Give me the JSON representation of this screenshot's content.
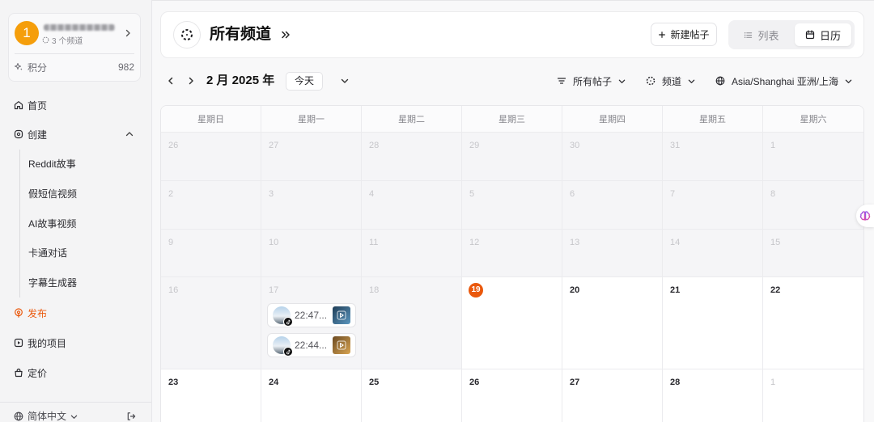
{
  "colors": {
    "accent": "#ea580c",
    "avatar": "#f59e0b",
    "past_cell": "#f5f5f7"
  },
  "sidebar": {
    "user": {
      "avatar_text": "1",
      "channels": "3 个频道",
      "channels_icon": "dotted-circle-icon"
    },
    "points": {
      "label": "积分",
      "value": "982",
      "icon": "sparkle-icon"
    },
    "home": {
      "label": "首页",
      "icon": "home-icon"
    },
    "create": {
      "label": "创建",
      "icon": "create-icon",
      "expanded": true,
      "items": [
        "Reddit故事",
        "假短信视频",
        "AI故事视频",
        "卡通对话",
        "字幕生成器"
      ]
    },
    "publish": {
      "label": "发布",
      "icon": "broadcast-icon",
      "active": true
    },
    "projects": {
      "label": "我的项目",
      "icon": "play-square-icon"
    },
    "pricing": {
      "label": "定价",
      "icon": "bag-icon"
    },
    "language": {
      "label": "简体中文",
      "icon": "globe-icon"
    }
  },
  "header": {
    "title": "所有频道",
    "new_post": "新建帖子",
    "views": [
      {
        "label": "列表",
        "icon": "list-icon"
      },
      {
        "label": "日历",
        "icon": "calendar-icon"
      }
    ],
    "active_view_index": 1
  },
  "toolbar": {
    "month": "2 月 2025 年",
    "today": "今天",
    "post_filter": "所有帖子",
    "channel_filter": "频道",
    "timezone": "Asia/Shanghai 亚洲/上海"
  },
  "calendar": {
    "weekdays": [
      "星期日",
      "星期一",
      "星期二",
      "星期三",
      "星期四",
      "星期五",
      "星期六"
    ],
    "weeks": [
      [
        {
          "day": 26,
          "past": true,
          "other_month": true
        },
        {
          "day": 27,
          "past": true,
          "other_month": true
        },
        {
          "day": 28,
          "past": true,
          "other_month": true
        },
        {
          "day": 29,
          "past": true,
          "other_month": true
        },
        {
          "day": 30,
          "past": true,
          "other_month": true
        },
        {
          "day": 31,
          "past": true,
          "other_month": true
        },
        {
          "day": 1,
          "past": true
        }
      ],
      [
        {
          "day": 2,
          "past": true
        },
        {
          "day": 3,
          "past": true
        },
        {
          "day": 4,
          "past": true
        },
        {
          "day": 5,
          "past": true
        },
        {
          "day": 6,
          "past": true
        },
        {
          "day": 7,
          "past": true
        },
        {
          "day": 8,
          "past": true
        }
      ],
      [
        {
          "day": 9,
          "past": true
        },
        {
          "day": 10,
          "past": true
        },
        {
          "day": 11,
          "past": true
        },
        {
          "day": 12,
          "past": true
        },
        {
          "day": 13,
          "past": true
        },
        {
          "day": 14,
          "past": true
        },
        {
          "day": 15,
          "past": true
        }
      ],
      [
        {
          "day": 16,
          "past": true
        },
        {
          "day": 17,
          "past": true,
          "posts": [
            {
              "time": "22:47...",
              "platform_icon": "tiktok-icon",
              "thumb_colors": [
                "#1f3d57",
                "#5b97bf"
              ]
            },
            {
              "time": "22:44...",
              "platform_icon": "tiktok-icon",
              "thumb_colors": [
                "#6b4a22",
                "#d9a552"
              ]
            }
          ]
        },
        {
          "day": 18,
          "past": true
        },
        {
          "day": 19,
          "today": true
        },
        {
          "day": 20
        },
        {
          "day": 21
        },
        {
          "day": 22
        }
      ],
      [
        {
          "day": 23
        },
        {
          "day": 24
        },
        {
          "day": 25
        },
        {
          "day": 26
        },
        {
          "day": 27
        },
        {
          "day": 28
        },
        {
          "day": 1,
          "other_month": true
        }
      ]
    ]
  }
}
